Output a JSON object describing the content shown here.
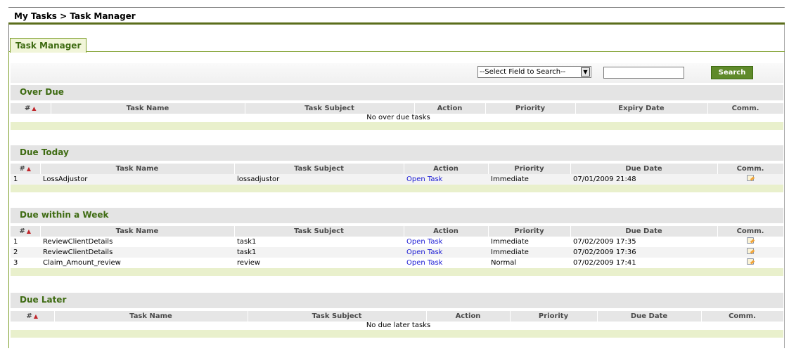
{
  "breadcrumb": "My Tasks > Task Manager",
  "tab": "Task Manager",
  "search": {
    "select_value": "--Select Field to Search--",
    "input_value": "",
    "button": "Search"
  },
  "sections": {
    "overdue": {
      "title": "Over Due",
      "columns": [
        "#",
        "Task Name",
        "Task Subject",
        "Action",
        "Priority",
        "Expiry Date",
        "Comm."
      ],
      "empty": "No over due tasks"
    },
    "today": {
      "title": "Due Today",
      "columns": [
        "#",
        "Task Name",
        "Task Subject",
        "Action",
        "Priority",
        "Due Date",
        "Comm."
      ],
      "rows": [
        {
          "num": "1",
          "name": "LossAdjustor",
          "subject": "lossadjustor",
          "action": "Open Task",
          "priority": "Immediate",
          "date": "07/01/2009 21:48"
        }
      ]
    },
    "week": {
      "title": "Due within a Week",
      "columns": [
        "#",
        "Task Name",
        "Task Subject",
        "Action",
        "Priority",
        "Due Date",
        "Comm."
      ],
      "rows": [
        {
          "num": "1",
          "name": "ReviewClientDetails",
          "subject": "task1",
          "action": "Open Task",
          "priority": "Immediate",
          "date": "07/02/2009 17:35"
        },
        {
          "num": "2",
          "name": "ReviewClientDetails",
          "subject": "task1",
          "action": "Open Task",
          "priority": "Immediate",
          "date": "07/02/2009 17:36"
        },
        {
          "num": "3",
          "name": "Claim_Amount_review",
          "subject": "review",
          "action": "Open Task",
          "priority": "Normal",
          "date": "07/02/2009 17:41"
        }
      ]
    },
    "later": {
      "title": "Due Later",
      "columns": [
        "#",
        "Task Name",
        "Task Subject",
        "Action",
        "Priority",
        "Due Date",
        "Comm."
      ],
      "empty": "No due later tasks"
    }
  },
  "icons": {
    "sort": "sort-ascending-icon",
    "comment": "comment-edit-icon",
    "dropdown": "chevron-down-icon"
  },
  "colors": {
    "accent": "#5b6e1c",
    "section_title": "#3e6b12",
    "link": "#1a1ad4",
    "sort": "#c0262b"
  }
}
